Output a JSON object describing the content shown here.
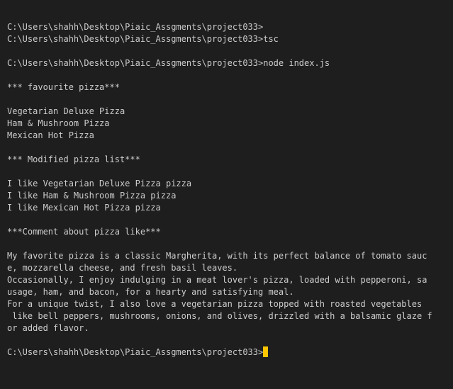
{
  "terminal": {
    "cursor_color": "#ffc600",
    "background_color": "#1e1e1e",
    "text_color": "#cccccc",
    "lines": [
      "C:\\Users\\shahh\\Desktop\\Piaic_Assgments\\project033>",
      "C:\\Users\\shahh\\Desktop\\Piaic_Assgments\\project033>tsc",
      "",
      "C:\\Users\\shahh\\Desktop\\Piaic_Assgments\\project033>node index.js",
      "",
      "*** favourite pizza***",
      "",
      "Vegetarian Deluxe Pizza",
      "Ham & Mushroom Pizza",
      "Mexican Hot Pizza",
      "",
      "*** Modified pizza list***",
      "",
      "I like Vegetarian Deluxe Pizza pizza",
      "I like Ham & Mushroom Pizza pizza",
      "I like Mexican Hot Pizza pizza",
      "",
      "***Comment about pizza like***",
      "",
      "My favorite pizza is a classic Margherita, with its perfect balance of tomato sauc",
      "e, mozzarella cheese, and fresh basil leaves.",
      "Occasionally, I enjoy indulging in a meat lover's pizza, loaded with pepperoni, sa",
      "usage, ham, and bacon, for a hearty and satisfying meal.",
      "For a unique twist, I also love a vegetarian pizza topped with roasted vegetables",
      " like bell peppers, mushrooms, onions, and olives, drizzled with a balsamic glaze f",
      "or added flavor.",
      "",
      "C:\\Users\\shahh\\Desktop\\Piaic_Assgments\\project033>"
    ]
  }
}
